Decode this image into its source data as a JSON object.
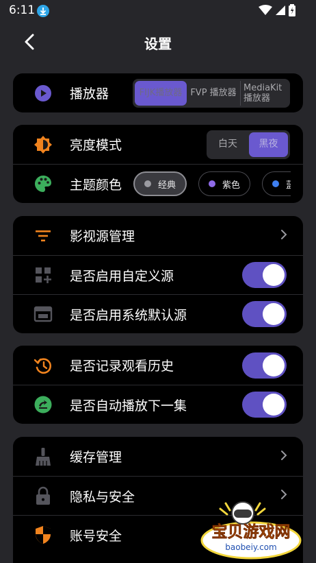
{
  "status_bar": {
    "time": "6:11"
  },
  "header": {
    "title": "设置"
  },
  "player": {
    "label": "播放器",
    "options": [
      {
        "line1": "FIJK播放器",
        "line2": "",
        "selected": true
      },
      {
        "line1": "FVP 播放器",
        "line2": "",
        "selected": false
      },
      {
        "line1": "MediaKit",
        "line2": "播放器",
        "selected": false
      }
    ]
  },
  "appearance": {
    "brightness_label": "亮度模式",
    "brightness_options": [
      {
        "label": "白天",
        "selected": false
      },
      {
        "label": "黑夜",
        "selected": true
      }
    ],
    "theme_label": "主题颜色",
    "theme_options": [
      {
        "label": "经典",
        "color": "#9a9aa0",
        "selected": true
      },
      {
        "label": "紫色",
        "color": "#8f6be8",
        "selected": false
      },
      {
        "label": "蓝色",
        "color": "#3e7ff0",
        "selected": false
      }
    ]
  },
  "sources": {
    "manage_label": "影视源管理",
    "custom_label": "是否启用自定义源",
    "custom_enabled": true,
    "default_label": "是否启用系统默认源",
    "default_enabled": true
  },
  "playback": {
    "history_label": "是否记录观看历史",
    "history_enabled": true,
    "autoplay_label": "是否自动播放下一集",
    "autoplay_enabled": true
  },
  "misc": {
    "cache_label": "缓存管理",
    "privacy_label": "隐私与安全",
    "account_label": "账号安全"
  },
  "watermark": {
    "title": "宝贝游戏网",
    "domain": "baobeiy.com"
  },
  "colors": {
    "accent": "#6a59cf",
    "toggle_on": "#5f51c2",
    "orange": "#f0831e",
    "green": "#3cae5c",
    "background": "#26262a",
    "card": "#000000"
  }
}
